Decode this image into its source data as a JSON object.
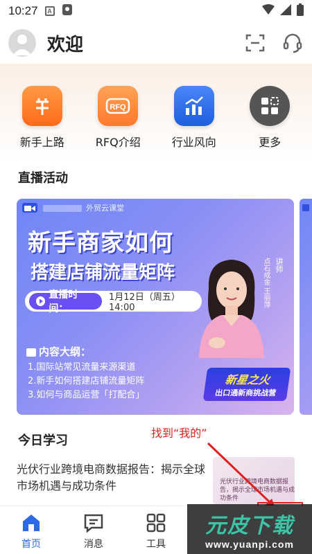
{
  "status_bar": {
    "time": "10:27",
    "badge": "A"
  },
  "header": {
    "title": "欢迎"
  },
  "quick_actions": [
    {
      "label": "新手上路",
      "icon": "beginner-icon",
      "color": "#ff7a2e"
    },
    {
      "label": "RFQ介绍",
      "icon": "rfq-icon",
      "color": "#ff8a3a"
    },
    {
      "label": "行业风向",
      "icon": "trend-chart-icon",
      "color": "#2d6ae8"
    },
    {
      "label": "更多",
      "icon": "more-grid-icon",
      "color": "#555555"
    }
  ],
  "live_section": {
    "title": "直播活动",
    "banner": {
      "brand": "外贸云课堂",
      "title_line1": "新手商家如何",
      "title_line2": "搭建店铺流量矩阵",
      "time_label": "直播时间：",
      "time_value": "1月12日（周五）14:00",
      "outline_title": "内容大纲：",
      "outline": [
        "1.国际站常见流量来源渠道",
        "2.新手如何搭建店铺流量矩阵",
        "3.如何与商品运营「打配合」"
      ],
      "speaker_tag": "讲师",
      "speaker_name": "点石成金 王丽萍",
      "badge_line1": "新星之火",
      "badge_line2": "出口通新商挑战营"
    }
  },
  "study_section": {
    "title": "今日学习",
    "annotation": "找到“我的”",
    "article_title": "光伏行业跨境电商数据报告：揭示全球市场机遇与成功条件",
    "thumb_text": "光伏行业跨境电商数据报告，揭示全球市场机遇与成功条件"
  },
  "bottom_nav": [
    {
      "label": "首页",
      "icon": "home-icon",
      "active": true
    },
    {
      "label": "消息",
      "icon": "message-icon",
      "active": false
    },
    {
      "label": "工具",
      "icon": "tools-icon",
      "active": false
    }
  ],
  "watermark": {
    "main": "元皮下载",
    "sub": "www.yuanpi.com"
  },
  "colors": {
    "accent": "#2d6ae8",
    "annotation": "#e02020"
  }
}
